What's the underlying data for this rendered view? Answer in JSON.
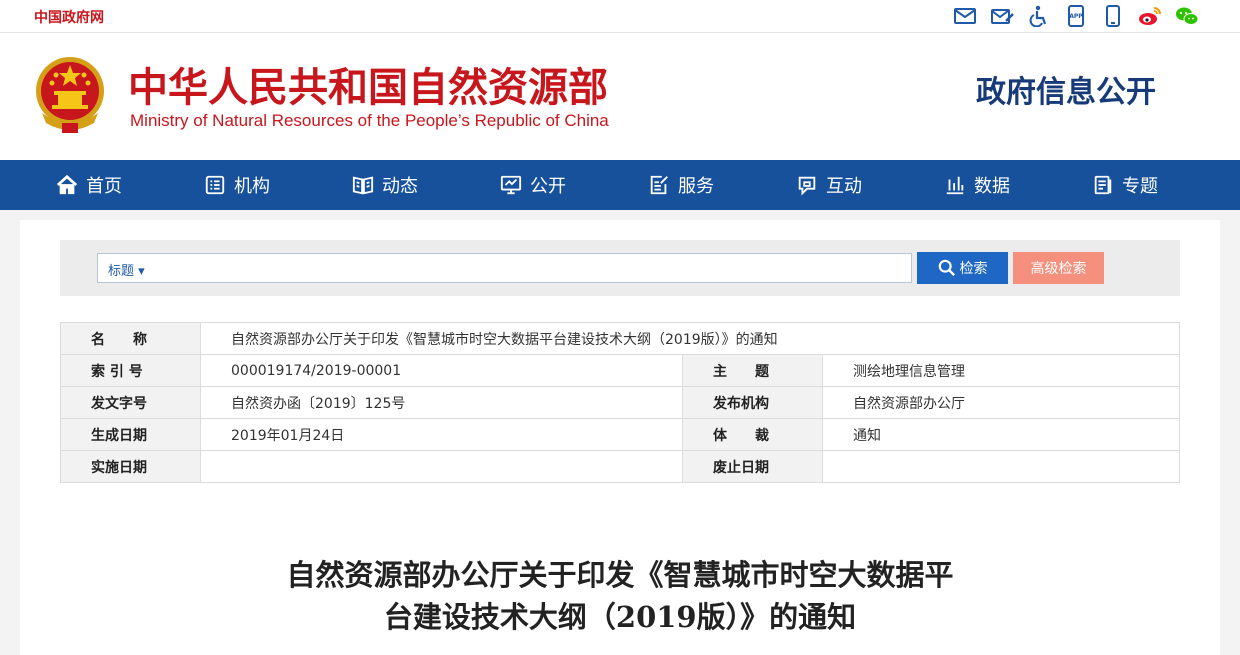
{
  "topbar": {
    "gov_link": "中国政府网",
    "icons": [
      "mail-icon",
      "mail-edit-icon",
      "accessibility-icon",
      "app-icon",
      "mobile-icon",
      "weibo-icon",
      "wechat-icon"
    ]
  },
  "header": {
    "title_cn": "中华人民共和国自然资源部",
    "title_en": "Ministry of Natural Resources of the People’s Republic of China",
    "section": "政府信息公开"
  },
  "nav": [
    {
      "label": "首页",
      "icon": "home-icon"
    },
    {
      "label": "机构",
      "icon": "org-icon"
    },
    {
      "label": "动态",
      "icon": "book-icon"
    },
    {
      "label": "公开",
      "icon": "monitor-icon"
    },
    {
      "label": "服务",
      "icon": "edit-doc-icon"
    },
    {
      "label": "互动",
      "icon": "chat-icon"
    },
    {
      "label": "数据",
      "icon": "bar-chart-icon"
    },
    {
      "label": "专题",
      "icon": "topic-icon"
    }
  ],
  "search": {
    "scope": "标题 ▾",
    "value": "",
    "button": "检索",
    "advanced": "高级检索"
  },
  "meta": {
    "name_label": "名　　称",
    "name_value": "自然资源部办公厅关于印发《智慧城市时空大数据平台建设技术大纲（2019版）》的通知",
    "index_label": "索 引 号",
    "index_value": "000019174/2019-00001",
    "subject_label": "主　　题",
    "subject_value": "测绘地理信息管理",
    "docno_label": "发文字号",
    "docno_value": "自然资办函〔2019〕125号",
    "issuer_label": "发布机构",
    "issuer_value": "自然资源部办公厅",
    "date_label": "生成日期",
    "date_value": "2019年01月24日",
    "genre_label": "体　　裁",
    "genre_value": "通知",
    "effective_label": "实施日期",
    "effective_value": "",
    "abolish_label": "废止日期",
    "abolish_value": ""
  },
  "article": {
    "title_line1": "自然资源部办公厅关于印发《智慧城市时空大数据平",
    "title_line2": "台建设技术大纲（2019版）》的通知"
  },
  "colors": {
    "brand_red": "#c8161d",
    "nav_blue": "#17519c",
    "search_blue": "#1f67c4",
    "advanced_salmon": "#f4907d"
  }
}
